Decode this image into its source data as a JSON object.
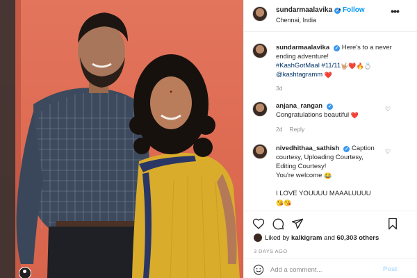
{
  "header": {
    "username": "sundarmaalavika",
    "separator": "•",
    "follow_label": "Follow",
    "location": "Chennai, India",
    "more_label": "•••"
  },
  "caption": {
    "username": "sundarmaalavika",
    "text": "Here's to a never ending adventure!",
    "hashtags": "#KashGotMaal #11/11",
    "emojis_line1": "🤟🏼❤️🔥💍",
    "mention": "@kashtagramm",
    "mention_emoji": "❤️",
    "time": "3d"
  },
  "comments": [
    {
      "username": "anjana_rangan",
      "text": "Congratulations beautiful",
      "emoji": "❤️",
      "time": "2d",
      "reply_label": "Reply"
    },
    {
      "username": "nivedhithaa_sathish",
      "line1": "Caption",
      "line2": "courtesy, Uploading Courtesy,",
      "line3": "Editing Courtesy!",
      "line4": "You're welcome",
      "line4_emoji": "😂",
      "line5": "I LOVE YOUUUU MAAALUUUU",
      "line6_emoji": "😘😘"
    }
  ],
  "actions": {
    "like_icon": "heart-icon",
    "comment_icon": "comment-icon",
    "share_icon": "share-icon",
    "save_icon": "bookmark-icon"
  },
  "likes": {
    "prefix": "Liked by",
    "user": "kalkigram",
    "middle": "and",
    "count": "60,303 others"
  },
  "time_ago": "3 DAYS AGO",
  "add_comment": {
    "placeholder": "Add a comment...",
    "post_label": "Post"
  },
  "colors": {
    "accent": "#0095f6",
    "verified": "#3897f0",
    "hashtag": "#00376b",
    "muted": "#8e8e8e",
    "wall": "#dd6b52"
  }
}
